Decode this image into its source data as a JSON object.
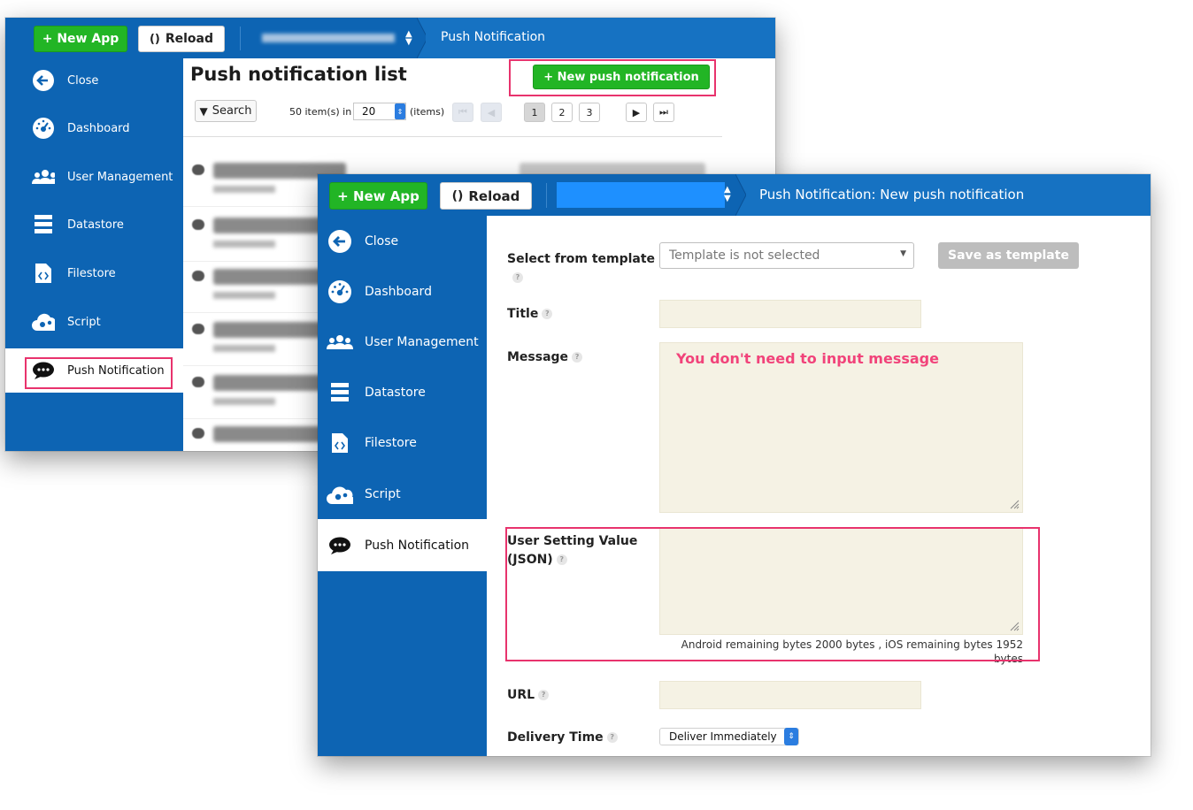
{
  "colors": {
    "brand_blue": "#0d64b3",
    "green_button": "#22b525",
    "highlight": "#e8336d",
    "note_pink": "#f1437a",
    "input_bg": "#f5f2e4"
  },
  "back_window": {
    "toolbar": {
      "new_app_label": "+ New App",
      "reload_label": "Reload",
      "breadcrumb": "Push Notification"
    },
    "sidebar": {
      "items": [
        {
          "label": "Close",
          "icon": "arrow-left-icon"
        },
        {
          "label": "Dashboard",
          "icon": "gauge-icon"
        },
        {
          "label": "User Management",
          "icon": "users-icon"
        },
        {
          "label": "Datastore",
          "icon": "database-icon"
        },
        {
          "label": "Filestore",
          "icon": "file-code-icon"
        },
        {
          "label": "Script",
          "icon": "cloud-gear-icon"
        },
        {
          "label": "Push Notification",
          "icon": "speech-bubble-icon",
          "active": true
        }
      ]
    },
    "list": {
      "title": "Push notification list",
      "new_button_label": "+ New push notification",
      "search_label": "Search",
      "items_prefix": "50 item(s) in",
      "per_page": "20",
      "items_suffix": "(items)",
      "pages": [
        "1",
        "2",
        "3"
      ]
    }
  },
  "front_window": {
    "toolbar": {
      "new_app_label": "+ New App",
      "reload_label": "Reload",
      "breadcrumb": "Push Notification: New push notification"
    },
    "sidebar": {
      "items": [
        {
          "label": "Close",
          "icon": "arrow-left-icon"
        },
        {
          "label": "Dashboard",
          "icon": "gauge-icon"
        },
        {
          "label": "User Management",
          "icon": "users-icon"
        },
        {
          "label": "Datastore",
          "icon": "database-icon"
        },
        {
          "label": "Filestore",
          "icon": "file-code-icon"
        },
        {
          "label": "Script",
          "icon": "cloud-gear-icon"
        },
        {
          "label": "Push Notification",
          "icon": "speech-bubble-icon",
          "active": true
        }
      ]
    },
    "form": {
      "template_label": "Select from template",
      "template_placeholder": "Template is not selected",
      "save_template_label": "Save as template",
      "title_label": "Title",
      "message_label": "Message",
      "message_note": "You don't need to input message",
      "user_setting_label_1": "User Setting Value",
      "user_setting_label_2": "(JSON)",
      "remaining_text": "Android remaining bytes 2000 bytes , iOS remaining bytes 1952 bytes",
      "url_label": "URL",
      "delivery_label": "Delivery Time",
      "delivery_value": "Deliver Immediately",
      "help_glyph": "?"
    }
  }
}
